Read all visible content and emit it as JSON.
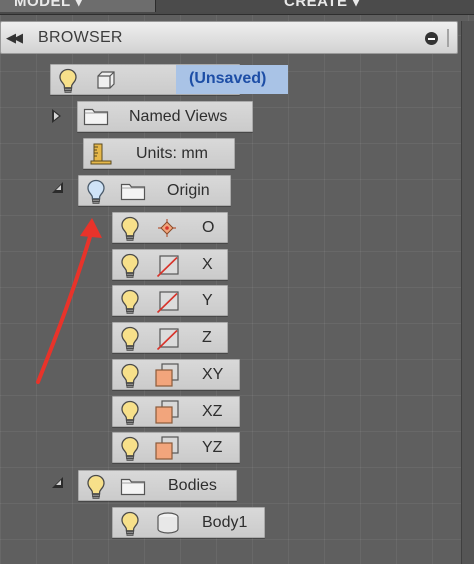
{
  "top_tabs": {
    "model": "MODEL ▾",
    "create": "CREATE ▾"
  },
  "browser": {
    "title": "BROWSER"
  },
  "tree": {
    "root": {
      "label": "(Unsaved)",
      "state": "expanded"
    },
    "named_views": {
      "label": "Named Views",
      "state": "collapsed"
    },
    "units": {
      "label": "Units: mm"
    },
    "origin": {
      "label": "Origin",
      "state": "expanded",
      "items": [
        {
          "label": "O",
          "icon": "origin-point-icon"
        },
        {
          "label": "X",
          "icon": "axis-icon"
        },
        {
          "label": "Y",
          "icon": "axis-icon"
        },
        {
          "label": "Z",
          "icon": "axis-icon"
        },
        {
          "label": "XY",
          "icon": "plane-icon"
        },
        {
          "label": "XZ",
          "icon": "plane-icon"
        },
        {
          "label": "YZ",
          "icon": "plane-icon"
        }
      ]
    },
    "bodies": {
      "label": "Bodies",
      "state": "expanded",
      "items": [
        {
          "label": "Body1",
          "icon": "body-icon"
        }
      ]
    }
  },
  "colors": {
    "accent": "#1d4ea6",
    "selection": "#a9c3e6",
    "annotation_arrow": "#e8332a",
    "plane": "#f2a57c"
  }
}
